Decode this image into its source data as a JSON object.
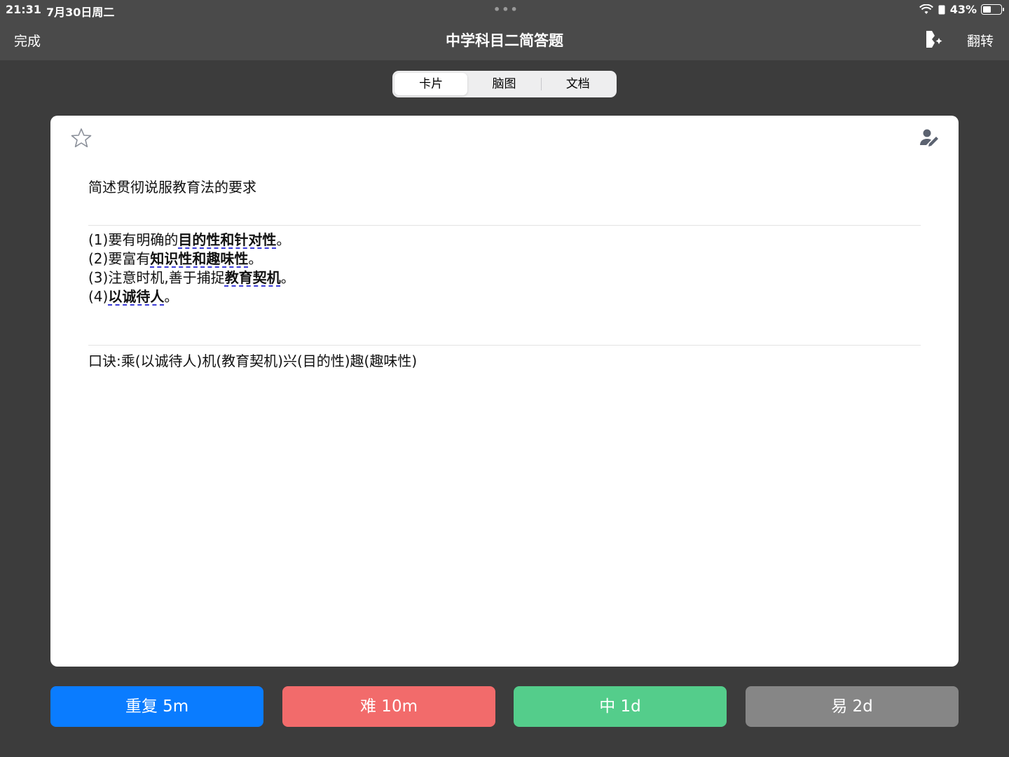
{
  "status_bar": {
    "time": "21:31",
    "date": "7月30日周二",
    "dots": "•••",
    "battery": "43%",
    "battery_level": 0.43
  },
  "nav": {
    "done_label": "完成",
    "title": "中学科目二简答题",
    "flip_label": "翻转",
    "anki_icon": "person-sparkle-icon"
  },
  "tabs": [
    {
      "label": "卡片",
      "active": true
    },
    {
      "label": "脑图",
      "active": false
    },
    {
      "label": "文档",
      "active": false
    }
  ],
  "card": {
    "star_icon": "star-icon",
    "edit_icon": "person-edit-icon",
    "question": "简述贯彻说服教育法的要求",
    "answer_lines": [
      {
        "prefix": "(1)要有明确的",
        "bold": "目的性和针对性",
        "suffix": "。"
      },
      {
        "prefix": "(2)要富有",
        "bold": "知识性和趣味性",
        "suffix": "。"
      },
      {
        "prefix": "(3)注意时机,善于捕捉",
        "bold": "教育契机",
        "suffix": "。"
      },
      {
        "prefix": "(4)",
        "bold": "以诚待人",
        "suffix": "。"
      }
    ],
    "mnemonic": "口诀:乘(以诚待人)机(教育契机)兴(目的性)趣(趣味性)"
  },
  "answer_buttons": {
    "again": "重复 5m",
    "hard": "难 10m",
    "good": "中 1d",
    "easy": "易 2d"
  },
  "colors": {
    "again": "#0a7cff",
    "hard": "#f26b6b",
    "good": "#54cd8b",
    "easy": "#868686"
  }
}
